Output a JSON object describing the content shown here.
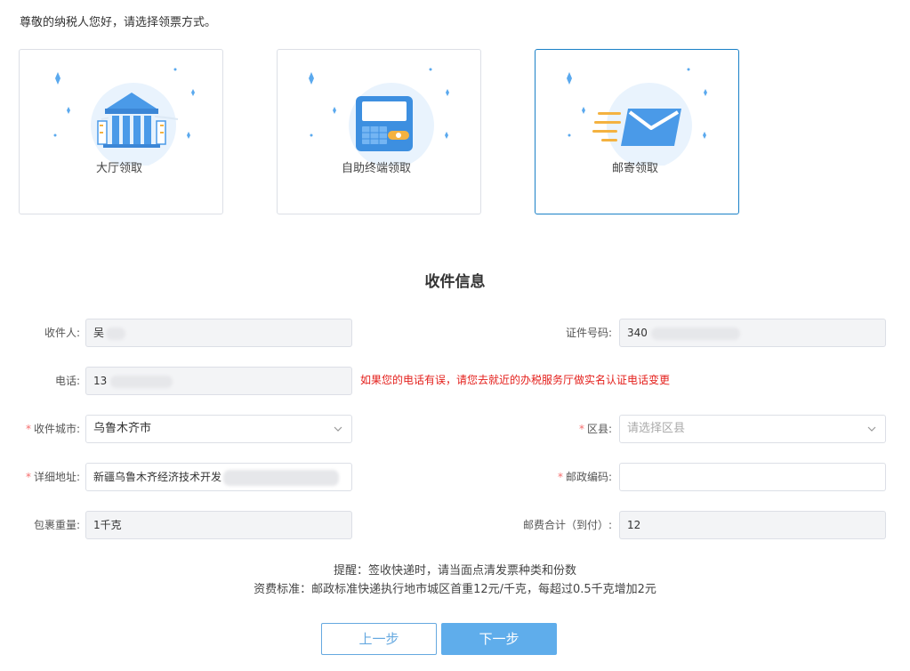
{
  "greeting": "尊敬的纳税人您好，请选择领票方式。",
  "pickup_options": [
    {
      "label": "大厅领取",
      "selected": false
    },
    {
      "label": "自助终端领取",
      "selected": false
    },
    {
      "label": "邮寄领取",
      "selected": true
    }
  ],
  "section_title": "收件信息",
  "form": {
    "recipient": {
      "label": "收件人:",
      "value": "吴"
    },
    "id_number": {
      "label": "证件号码:",
      "value": "340"
    },
    "phone": {
      "label": "电话:",
      "value": "13",
      "warning": "如果您的电话有误，请您去就近的办税服务厅做实名认证电话变更"
    },
    "city": {
      "label": "收件城市:",
      "value": "乌鲁木齐市",
      "required": "*"
    },
    "district": {
      "label": "区县:",
      "placeholder": "请选择区县",
      "required": "*"
    },
    "address": {
      "label": "详细地址:",
      "value": "新疆乌鲁木齐经济技术开发",
      "required": "*"
    },
    "postcode": {
      "label": "邮政编码:",
      "value": "",
      "required": "*"
    },
    "weight": {
      "label": "包裹重量:",
      "value": "1千克"
    },
    "postage": {
      "label": "邮费合计（到付）:",
      "value": "12"
    }
  },
  "notes": {
    "reminder": "提醒：签收快递时，请当面点清发票种类和份数",
    "fee_standard": "资费标准：邮政标准快递执行地市城区首重12元/千克，每超过0.5千克增加2元"
  },
  "buttons": {
    "prev": "上一步",
    "next": "下一步"
  },
  "colors": {
    "accent": "#5fadeb",
    "selected_border": "#1a80c7",
    "warning": "#e4201c",
    "required": "#f56c6c",
    "disabled_bg": "#f3f4f6"
  },
  "icons": [
    "building-icon",
    "terminal-icon",
    "envelope-icon",
    "chevron-down-icon"
  ]
}
